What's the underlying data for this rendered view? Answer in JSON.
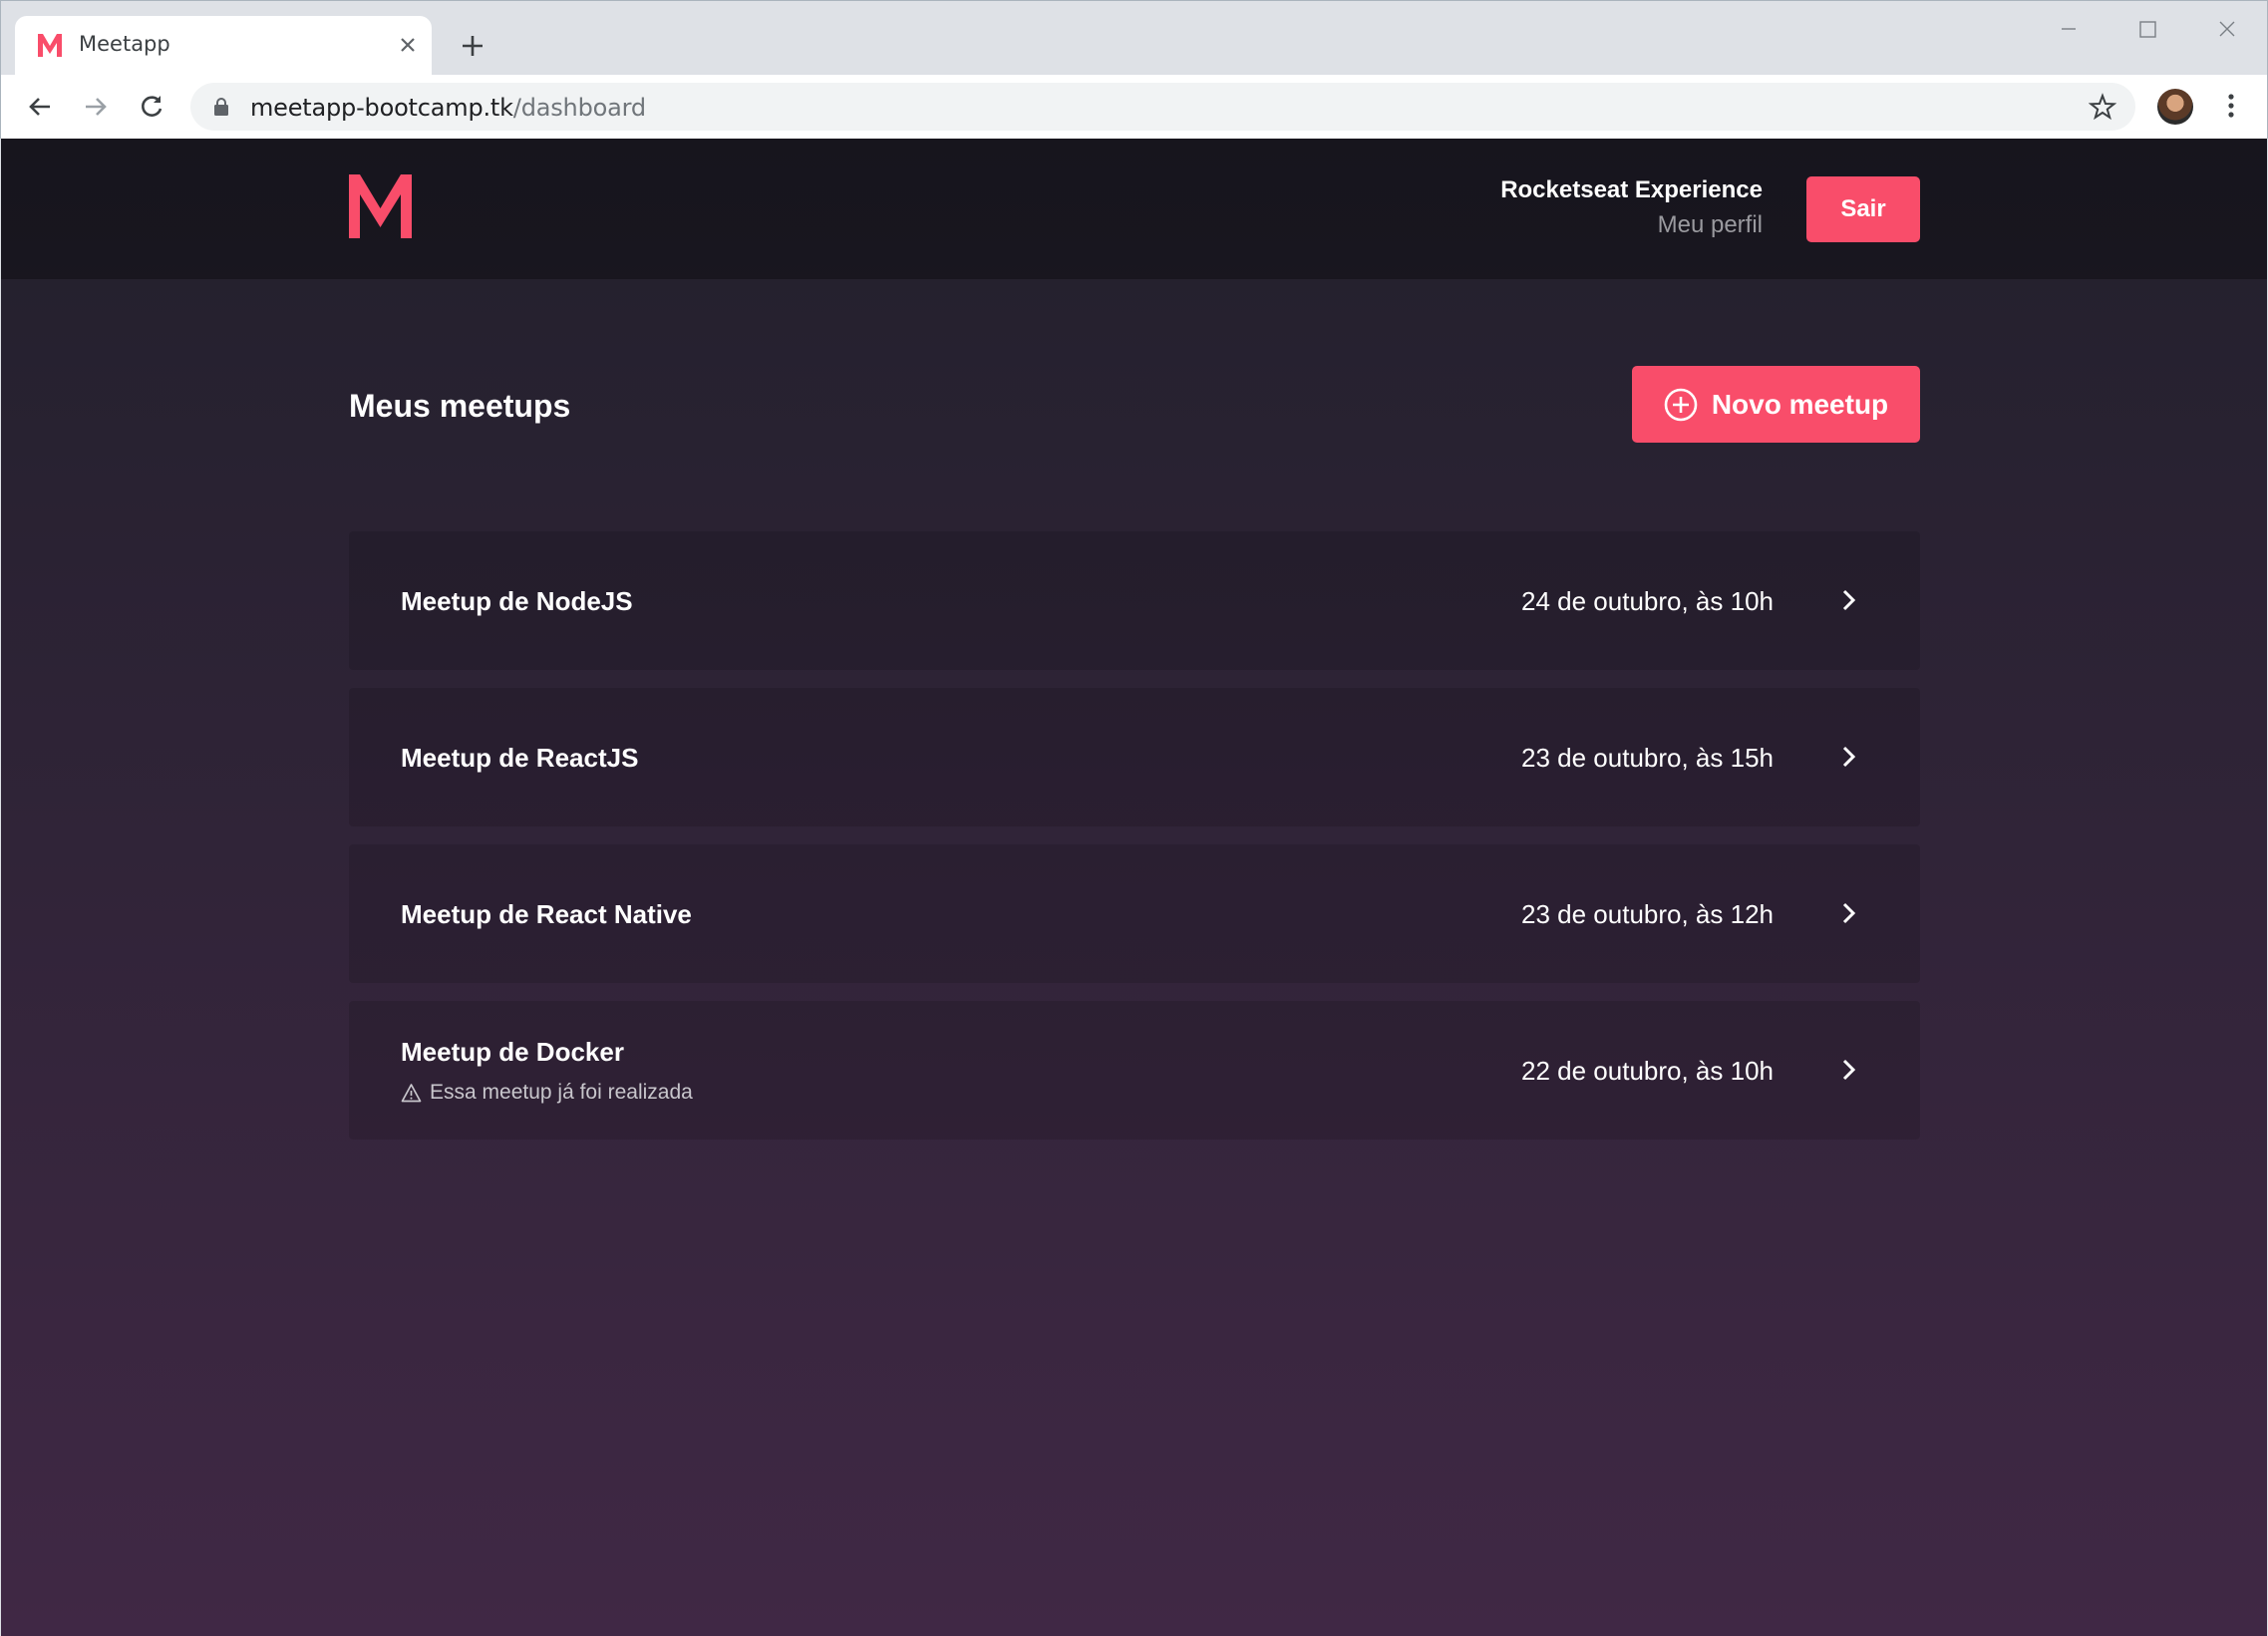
{
  "browser": {
    "tab_title": "Meetapp",
    "url_host": "meetapp-bootcamp.tk",
    "url_path": "/dashboard"
  },
  "header": {
    "user_name": "Rocketseat Experience",
    "profile_link": "Meu perfil",
    "logout_label": "Sair",
    "logo_icon": "meetapp-logo-icon"
  },
  "main": {
    "title": "Meus meetups",
    "new_button_label": "Novo meetup",
    "meetups": [
      {
        "title": "Meetup de NodeJS",
        "date": "24 de outubro, às 10h",
        "past_note": ""
      },
      {
        "title": "Meetup de ReactJS",
        "date": "23 de outubro, às 15h",
        "past_note": ""
      },
      {
        "title": "Meetup de React Native",
        "date": "23 de outubro, às 12h",
        "past_note": ""
      },
      {
        "title": "Meetup de Docker",
        "date": "22 de outubro, às 10h",
        "past_note": "Essa meetup já foi realizada"
      }
    ]
  },
  "colors": {
    "accent": "#f94d6a",
    "header_bg": "#18161f",
    "page_gradient_top": "#22202c",
    "page_gradient_bottom": "#402845"
  }
}
